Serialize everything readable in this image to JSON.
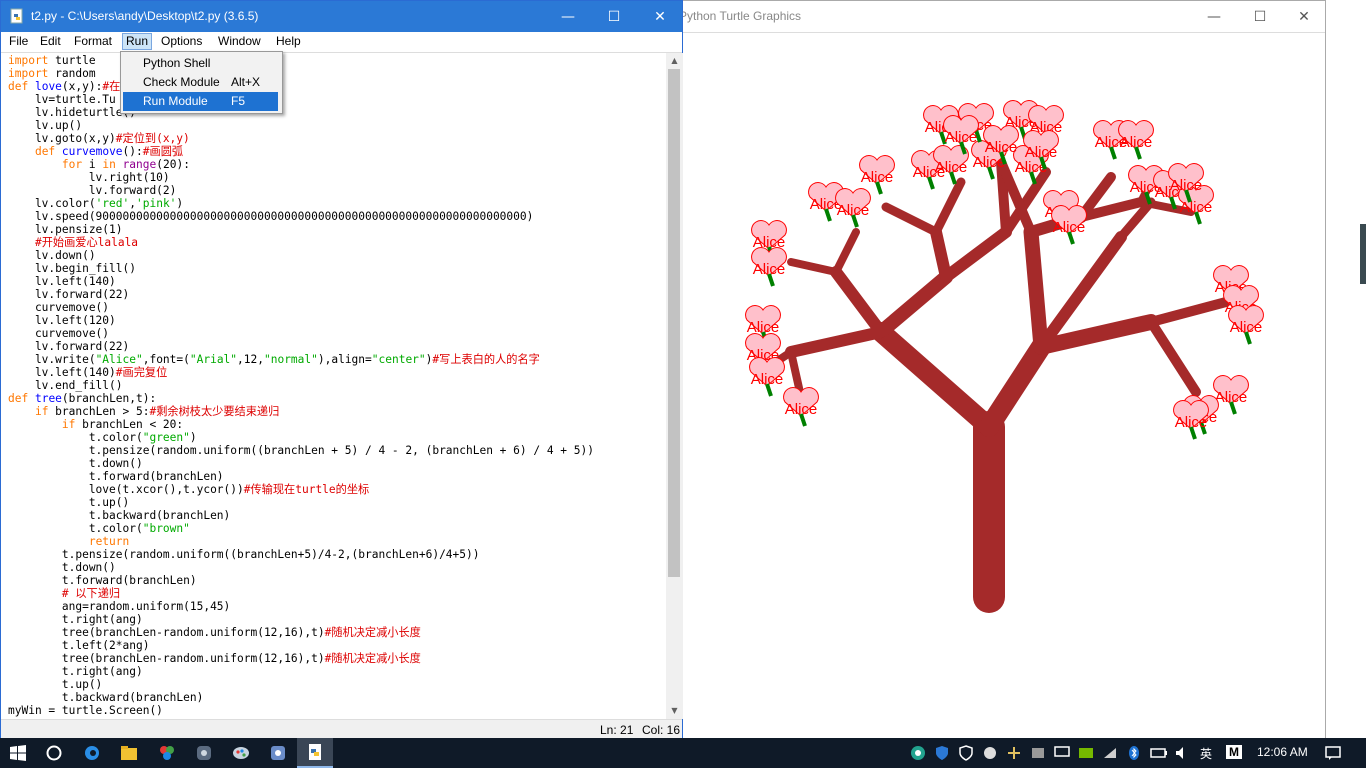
{
  "turtle_window": {
    "title": "Python Turtle Graphics",
    "controls": {
      "minimize": "—",
      "maximize": "☐",
      "close": "✕"
    },
    "heart_label": "Alice",
    "colors": {
      "trunk": "#a52a2a",
      "leaves": "#008000",
      "heart_fill": "#ffc0cb",
      "heart_outline": "#ff0000",
      "label": "#ff0000"
    }
  },
  "editor": {
    "title": "t2.py - C:\\Users\\andy\\Desktop\\t2.py (3.6.5)",
    "controls": {
      "minimize": "—",
      "maximize": "☐",
      "close": "✕"
    },
    "menu": [
      "File",
      "Edit",
      "Format",
      "Run",
      "Options",
      "Window",
      "Help"
    ],
    "active_menu": "Run",
    "run_menu": [
      {
        "label": "Python Shell",
        "accel": ""
      },
      {
        "label": "Check Module",
        "accel": "Alt+X"
      },
      {
        "label": "Run Module",
        "accel": "F5",
        "selected": true
      }
    ],
    "code_lines": [
      [
        [
          "import",
          "kw"
        ],
        [
          " turtle",
          "n"
        ]
      ],
      [
        [
          "import",
          "kw"
        ],
        [
          " random",
          "n"
        ]
      ],
      [
        [
          "def",
          "kw"
        ],
        [
          " ",
          "n"
        ],
        [
          "love",
          "fn"
        ],
        [
          "(x,y):",
          "n"
        ],
        [
          "#在",
          "cm"
        ]
      ],
      [
        [
          "    lv=turtle.Tu",
          "n"
        ]
      ],
      [
        [
          "    lv.hideturtle()",
          "n"
        ]
      ],
      [
        [
          "    lv.up()",
          "n"
        ]
      ],
      [
        [
          "    lv.goto(x,y)",
          "n"
        ],
        [
          "#定位到(x,y)",
          "cm"
        ]
      ],
      [
        [
          "    ",
          "n"
        ],
        [
          "def",
          "kw"
        ],
        [
          " ",
          "n"
        ],
        [
          "curvemove",
          "fn"
        ],
        [
          "():",
          "n"
        ],
        [
          "#画圆弧",
          "cm"
        ]
      ],
      [
        [
          "        ",
          "n"
        ],
        [
          "for",
          "kw"
        ],
        [
          " i ",
          "n"
        ],
        [
          "in",
          "kw"
        ],
        [
          " ",
          "n"
        ],
        [
          "range",
          "bi"
        ],
        [
          "(20):",
          "n"
        ]
      ],
      [
        [
          "            lv.right(10)",
          "n"
        ]
      ],
      [
        [
          "            lv.forward(2)",
          "n"
        ]
      ],
      [
        [
          "    lv.color(",
          "n"
        ],
        [
          "'red'",
          "str"
        ],
        [
          ",",
          "n"
        ],
        [
          "'pink'",
          "str"
        ],
        [
          ")",
          "n"
        ]
      ],
      [
        [
          "    lv.speed(9000000000000000000000000000000000000000000000000000000000000000)",
          "n"
        ]
      ],
      [
        [
          "    lv.pensize(1)",
          "n"
        ]
      ],
      [
        [
          "    ",
          "n"
        ],
        [
          "#开始画爱心lalala",
          "cm"
        ]
      ],
      [
        [
          "    lv.down()",
          "n"
        ]
      ],
      [
        [
          "    lv.begin_fill()",
          "n"
        ]
      ],
      [
        [
          "    lv.left(140)",
          "n"
        ]
      ],
      [
        [
          "    lv.forward(22)",
          "n"
        ]
      ],
      [
        [
          "    curvemove()",
          "n"
        ]
      ],
      [
        [
          "    lv.left(120)",
          "n"
        ]
      ],
      [
        [
          "    curvemove()",
          "n"
        ]
      ],
      [
        [
          "    lv.forward(22)",
          "n"
        ]
      ],
      [
        [
          "    lv.write(",
          "n"
        ],
        [
          "\"Alice\"",
          "str"
        ],
        [
          ",font=(",
          "n"
        ],
        [
          "\"Arial\"",
          "str"
        ],
        [
          ",12,",
          "n"
        ],
        [
          "\"normal\"",
          "str"
        ],
        [
          "),align=",
          "n"
        ],
        [
          "\"center\"",
          "str"
        ],
        [
          ")",
          "n"
        ],
        [
          "#写上表白的人的名字",
          "cm"
        ]
      ],
      [
        [
          "    lv.left(140)",
          "n"
        ],
        [
          "#画完复位",
          "cm"
        ]
      ],
      [
        [
          "    lv.end_fill()",
          "n"
        ]
      ],
      [
        [
          "def",
          "kw"
        ],
        [
          " ",
          "n"
        ],
        [
          "tree",
          "fn"
        ],
        [
          "(branchLen,t):",
          "n"
        ]
      ],
      [
        [
          "    ",
          "n"
        ],
        [
          "if",
          "kw"
        ],
        [
          " branchLen > 5:",
          "n"
        ],
        [
          "#剩余树枝太少要结束递归",
          "cm"
        ]
      ],
      [
        [
          "        ",
          "n"
        ],
        [
          "if",
          "kw"
        ],
        [
          " branchLen < 20:",
          "n"
        ]
      ],
      [
        [
          "            t.color(",
          "n"
        ],
        [
          "\"green\"",
          "str"
        ],
        [
          ")",
          "n"
        ]
      ],
      [
        [
          "            t.pensize(random.uniform((branchLen + 5) / 4 - 2, (branchLen + 6) / 4 + 5))",
          "n"
        ]
      ],
      [
        [
          "            t.down()",
          "n"
        ]
      ],
      [
        [
          "            t.forward(branchLen)",
          "n"
        ]
      ],
      [
        [
          "            love(t.xcor(),t.ycor())",
          "n"
        ],
        [
          "#传输现在turtle的坐标",
          "cm"
        ]
      ],
      [
        [
          "            t.up()",
          "n"
        ]
      ],
      [
        [
          "            t.backward(branchLen)",
          "n"
        ]
      ],
      [
        [
          "            t.color(",
          "n"
        ],
        [
          "\"brown\"",
          "str"
        ]
      ],
      [
        [
          "            ",
          "n"
        ],
        [
          "return",
          "kw"
        ]
      ],
      [
        [
          "        t.pensize(random.uniform((branchLen+5)/4-2,(branchLen+6)/4+5))",
          "n"
        ]
      ],
      [
        [
          "        t.down()",
          "n"
        ]
      ],
      [
        [
          "        t.forward(branchLen)",
          "n"
        ]
      ],
      [
        [
          "        ",
          "n"
        ],
        [
          "# 以下递归",
          "cm"
        ]
      ],
      [
        [
          "        ang=random.uniform(15,45)",
          "n"
        ]
      ],
      [
        [
          "        t.right(ang)",
          "n"
        ]
      ],
      [
        [
          "        tree(branchLen-random.uniform(12,16),t)",
          "n"
        ],
        [
          "#随机决定减小长度",
          "cm"
        ]
      ],
      [
        [
          "        t.left(2*ang)",
          "n"
        ]
      ],
      [
        [
          "        tree(branchLen-random.uniform(12,16),t)",
          "n"
        ],
        [
          "#随机决定减小长度",
          "cm"
        ]
      ],
      [
        [
          "        t.right(ang)",
          "n"
        ]
      ],
      [
        [
          "        t.up()",
          "n"
        ]
      ],
      [
        [
          "        t.backward(branchLen)",
          "n"
        ]
      ],
      [
        [
          "myWin = turtle.Screen()",
          "n"
        ]
      ]
    ],
    "syntax_colors": {
      "kw": "#ff7700",
      "fn": "#0000ff",
      "bi": "#900090",
      "str": "#00aa00",
      "cm": "#dd0000",
      "n": "#000000"
    },
    "status": {
      "line": "Ln: 21",
      "col": "Col: 16"
    }
  },
  "taskbar": {
    "icons": [
      "windows-start",
      "cortana",
      "edge-browser",
      "file-explorer",
      "color-app",
      "python-app",
      "paint-app",
      "network-app",
      "idle-python"
    ],
    "tray": {
      "lang": "英",
      "ime": "M",
      "clock": "12:06 AM"
    }
  }
}
